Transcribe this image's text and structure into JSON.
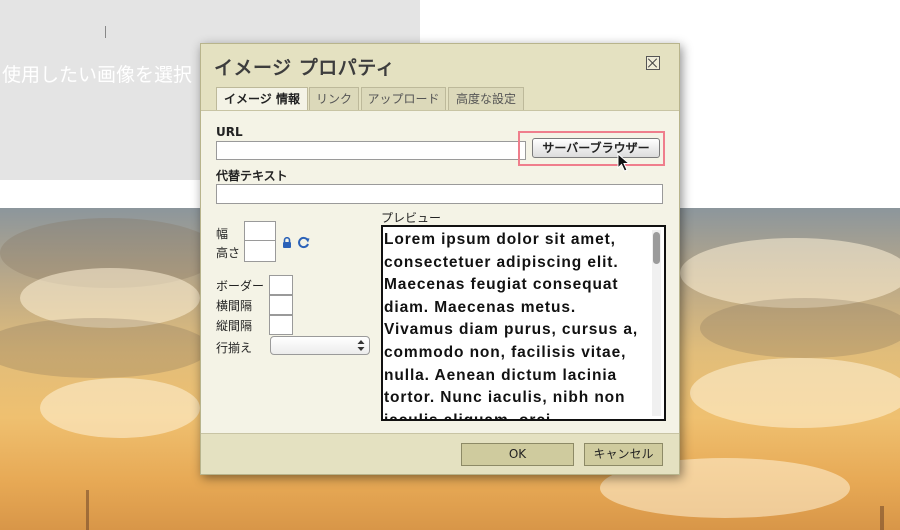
{
  "background": {
    "editor_text": "使用したい画像を選択"
  },
  "dialog": {
    "title": "イメージ プロパティ",
    "tabs": [
      {
        "label": "イメージ 情報",
        "active": true
      },
      {
        "label": "リンク",
        "active": false
      },
      {
        "label": "アップロード",
        "active": false
      },
      {
        "label": "高度な設定",
        "active": false
      }
    ],
    "url": {
      "label": "URL",
      "value": "",
      "browse_button": "サーバーブラウザー"
    },
    "alt_text": {
      "label": "代替テキスト",
      "value": ""
    },
    "width": {
      "label": "幅",
      "value": ""
    },
    "height": {
      "label": "高さ",
      "value": ""
    },
    "border": {
      "label": "ボーダー",
      "value": ""
    },
    "hspace": {
      "label": "横間隔",
      "value": ""
    },
    "vspace": {
      "label": "縦間隔",
      "value": ""
    },
    "align": {
      "label": "行揃え",
      "selected": ""
    },
    "preview": {
      "label": "プレビュー",
      "text": "Lorem ipsum dolor sit amet, consectetuer adipiscing elit. Maecenas feugiat consequat diam. Maecenas metus. Vivamus diam purus, cursus a, commodo non, facilisis vitae, nulla. Aenean dictum lacinia tortor. Nunc iaculis, nibh non iaculis aliquam, orci"
    },
    "ok_button": "OK",
    "cancel_button": "キャンセル"
  },
  "colors": {
    "dialog_bg": "#e4e1c1",
    "panel_bg": "#f4f3e6",
    "highlight": "#ef7e8c",
    "icon_blue": "#2b62b8"
  }
}
